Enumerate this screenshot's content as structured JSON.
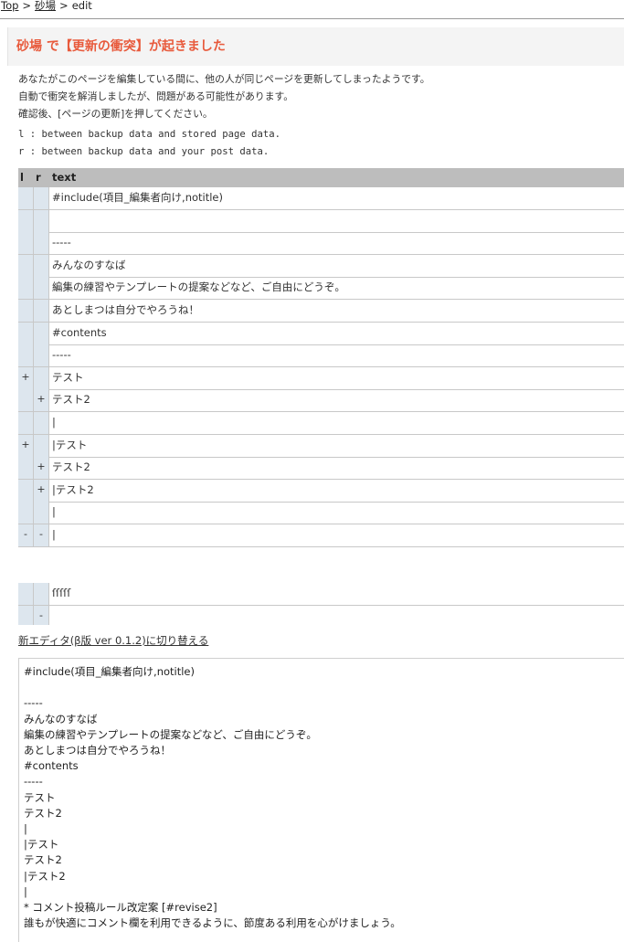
{
  "breadcrumb": {
    "items": [
      "Top",
      "砂場",
      "edit"
    ],
    "separator": ">"
  },
  "heading": "砂場 で【更新の衝突】が起きました",
  "messages": [
    "あなたがこのページを編集している間に、他の人が同じページを更新してしまったようです。",
    "自動で衝突を解消しましたが、問題がある可能性があります。",
    "確認後、[ページの更新]を押してください。"
  ],
  "legend": [
    "l : between backup data and stored page data.",
    "r : between backup data and your post data."
  ],
  "diff": {
    "headers": {
      "l": "l",
      "r": "r",
      "text": "text"
    },
    "rows": [
      {
        "l": "",
        "r": "",
        "text": "#include(項目_編集者向け,notitle)"
      },
      {
        "l": "",
        "r": "",
        "text": ""
      },
      {
        "l": "",
        "r": "",
        "text": "-----"
      },
      {
        "l": "",
        "r": "",
        "text": "みんなのすなば"
      },
      {
        "l": "",
        "r": "",
        "text": "編集の練習やテンプレートの提案などなど、ご自由にどうぞ。"
      },
      {
        "l": "",
        "r": "",
        "text": "あとしまつは自分でやろうね！"
      },
      {
        "l": "",
        "r": "",
        "text": "#contents"
      },
      {
        "l": "",
        "r": "",
        "text": "-----"
      },
      {
        "l": "+",
        "r": "",
        "text": "テスト"
      },
      {
        "l": "",
        "r": "+",
        "text": "テスト2"
      },
      {
        "l": "",
        "r": "",
        "text": "|"
      },
      {
        "l": "+",
        "r": "",
        "text": "|テスト"
      },
      {
        "l": "",
        "r": "+",
        "text": "テスト2"
      },
      {
        "l": "",
        "r": "+",
        "text": "|テスト2"
      },
      {
        "l": "",
        "r": "",
        "text": "|"
      },
      {
        "l": "-",
        "r": "-",
        "text": "|"
      }
    ],
    "tail_rows": [
      {
        "l": "",
        "r": "",
        "text": "ſſſſſ"
      },
      {
        "l": "",
        "r": "-",
        "text": ""
      }
    ]
  },
  "switch_editor_label": "新エディタ(β版 ver 0.1.2)に切り替える",
  "editor_lines": [
    "#include(項目_編集者向け,notitle)",
    "",
    "-----",
    "みんなのすなば",
    "編集の練習やテンプレートの提案などなど、ご自由にどうぞ。",
    "あとしまつは自分でやろうね！",
    "#contents",
    "-----",
    "テスト",
    "テスト2",
    "|",
    "|テスト",
    "テスト2",
    "|テスト2",
    "|",
    "* コメント投稿ルール改定案 [#revise2]",
    "誰もが快適にコメント欄を利用できるように、節度ある利用を心がけましょう。"
  ]
}
